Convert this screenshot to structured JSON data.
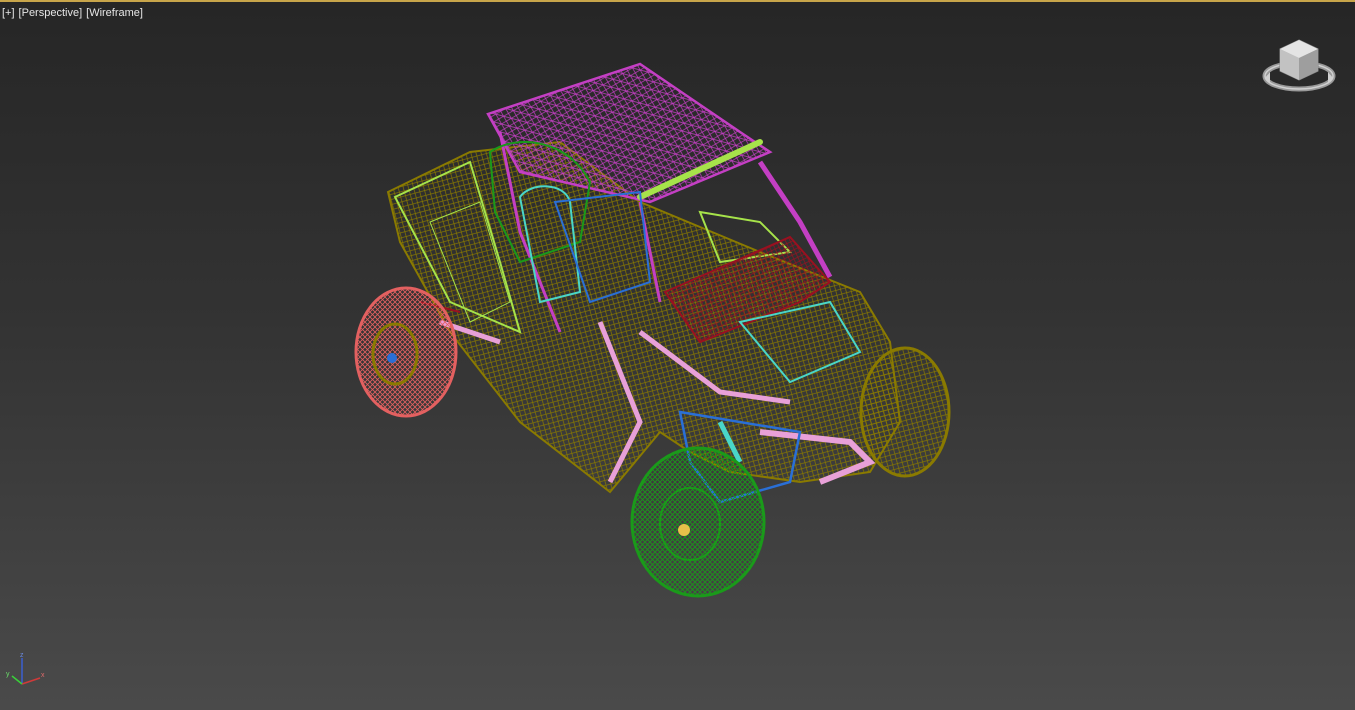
{
  "viewport": {
    "labels": {
      "menu": "[+]",
      "view": "[Perspective]",
      "shading": "[Wireframe]"
    },
    "accent_color": "#c8a54a",
    "viewcube_icon": "viewcube-icon",
    "axis_icon": "axis-tripod-icon",
    "axes": {
      "x": "x",
      "y": "y",
      "z": "z"
    },
    "wire_colors": {
      "olive": "#8a7a00",
      "magenta": "#c43fc4",
      "green": "#1a9a1a",
      "salmon": "#e36060",
      "blue": "#2a6fd6",
      "cyan": "#49d6c8",
      "pink": "#e8a0d8",
      "lime": "#a6e34a",
      "darkred": "#9a1020"
    }
  }
}
